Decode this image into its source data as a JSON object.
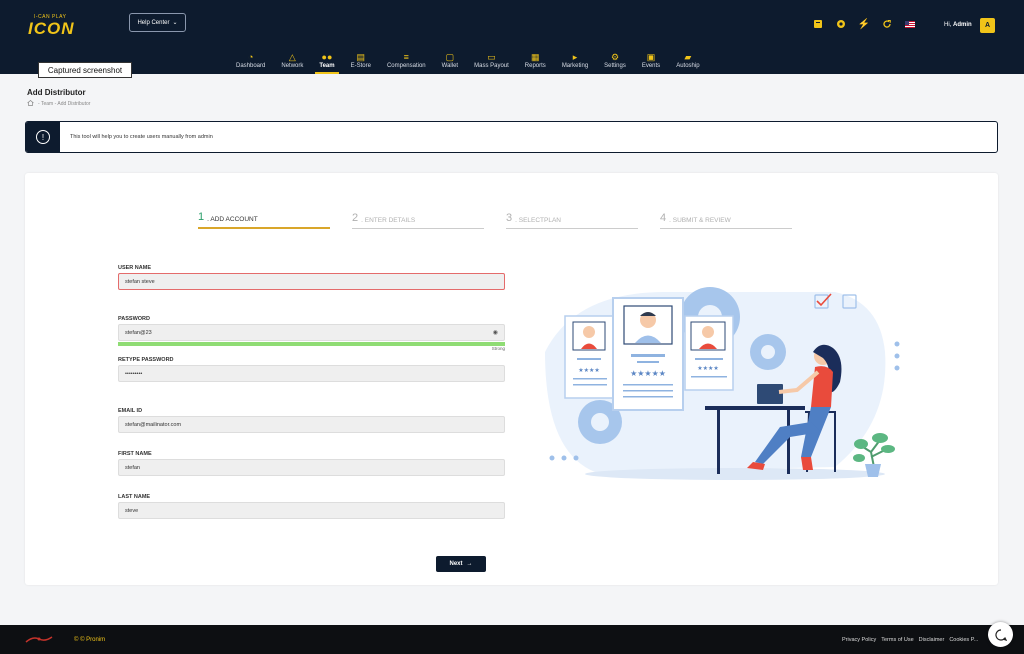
{
  "header": {
    "logo_small": "I-CAN PLAY",
    "logo_text": "ICON",
    "help_center": "Help Center",
    "greeting": "Hi,",
    "user_name": "Admin",
    "avatar_letter": "A",
    "accent_color": "#f0c419",
    "bg_color": "#0d1b2e"
  },
  "nav": {
    "items": [
      {
        "label": "Dashboard",
        "icon": "dashboard-icon"
      },
      {
        "label": "Network",
        "icon": "network-icon"
      },
      {
        "label": "Team",
        "icon": "team-icon"
      },
      {
        "label": "E-Store",
        "icon": "store-icon"
      },
      {
        "label": "Compensation",
        "icon": "sliders-icon"
      },
      {
        "label": "Wallet",
        "icon": "wallet-icon"
      },
      {
        "label": "Mass Payout",
        "icon": "card-icon"
      },
      {
        "label": "Reports",
        "icon": "report-icon"
      },
      {
        "label": "Marketing",
        "icon": "megaphone-icon"
      },
      {
        "label": "Settings",
        "icon": "gear-icon"
      },
      {
        "label": "Events",
        "icon": "calendar-icon"
      },
      {
        "label": "Autoship",
        "icon": "truck-icon"
      }
    ],
    "active": "Team"
  },
  "tooltip": "Captured screenshot",
  "page": {
    "title": "Add Distributor",
    "breadcrumb": "- Team - Add Distributor"
  },
  "alert": {
    "text": "This tool will help you to create users manually from admin"
  },
  "steps": [
    {
      "num": "1",
      "label": ". ADD ACCOUNT"
    },
    {
      "num": "2",
      "label": ". ENTER DETAILS"
    },
    {
      "num": "3",
      "label": ". SELECTPLAN"
    },
    {
      "num": "4",
      "label": ". SUBMIT & REVIEW"
    }
  ],
  "form": {
    "username_label": "USER NAME",
    "username_value": "stefan steve",
    "password_label": "PASSWORD",
    "password_value": "stefan@23",
    "password_strength_text": "Strong",
    "retype_label": "RETYPE PASSWORD",
    "retype_value": "•••••••••",
    "email_label": "EMAIL ID",
    "email_value": "stefan@mailinator.com",
    "first_name_label": "FIRST NAME",
    "first_name_value": "stefan",
    "last_name_label": "LAST NAME",
    "last_name_value": "steve"
  },
  "next_button": "Next",
  "footer": {
    "copyright": "© © Pronim",
    "links": [
      "Privacy Policy",
      "Terms of Use",
      "Disclaimer",
      "Cookies P..."
    ]
  }
}
